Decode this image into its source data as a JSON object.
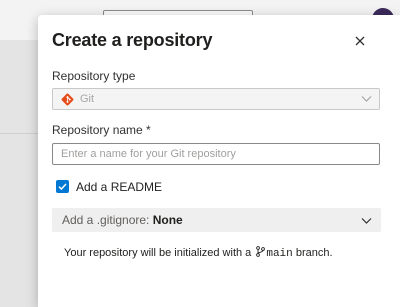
{
  "dialog": {
    "title": "Create a repository",
    "close_icon": "close-icon",
    "repository_type": {
      "label": "Repository type",
      "value": "Git",
      "icon": "git-icon"
    },
    "repository_name": {
      "label": "Repository name *",
      "placeholder": "Enter a name for your Git repository",
      "value": ""
    },
    "add_readme": {
      "label": "Add a README",
      "checked": true
    },
    "gitignore": {
      "prefix": "Add a .gitignore: ",
      "value": "None"
    },
    "info": {
      "text_before": "Your repository will be initialized with a",
      "branch": "main",
      "text_after": "branch."
    }
  },
  "colors": {
    "accent": "#0078d4",
    "git_icon": "#e64a19",
    "dialog_bg": "#ffffff",
    "overlay_bg": "#ebebeb"
  }
}
